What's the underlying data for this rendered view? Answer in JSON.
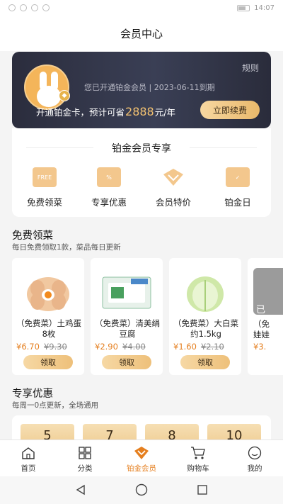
{
  "status_bar": {
    "time": "14:07"
  },
  "page": {
    "title": "会员中心"
  },
  "member_card": {
    "rule_link": "规则",
    "status_text": "您已开通铂金会员 | 2023-06-11到期",
    "promo_prefix": "开通铂金卡，预计可省",
    "promo_amount": "2888",
    "promo_suffix": "元/年",
    "renew_button": "立即续费"
  },
  "perks": {
    "title": "铂金会员专享",
    "items": [
      {
        "label": "免费领菜",
        "icon": "free-vegetable-icon",
        "icon_text": "FREE"
      },
      {
        "label": "专享优惠",
        "icon": "coupon-icon"
      },
      {
        "label": "会员特价",
        "icon": "diamond-tag-icon"
      },
      {
        "label": "铂金日",
        "icon": "calendar-icon"
      }
    ]
  },
  "free_dishes": {
    "title": "免费领菜",
    "subtitle": "每日免费领取1款，菜品每日更新",
    "items": [
      {
        "name": "（免费菜）土鸡蛋 8枚",
        "price": "¥6.70",
        "original_price": "¥9.30",
        "button": "领取"
      },
      {
        "name": "（免费菜）清美绢豆腐",
        "price": "¥2.90",
        "original_price": "¥4.00",
        "button": "领取"
      },
      {
        "name": "（免费菜）大白菜 约1.5kg",
        "price": "¥1.60",
        "original_price": "¥2.10",
        "button": "领取"
      },
      {
        "name": "（免",
        "line2": "娃娃",
        "price": "¥3.",
        "overlay": "已"
      }
    ]
  },
  "exclusive_deals": {
    "title": "专享优惠",
    "subtitle": "每周一0点更新，全场通用",
    "coupons": [
      "5",
      "7",
      "8",
      "10"
    ]
  },
  "tabbar": {
    "items": [
      {
        "label": "首页",
        "icon": "home-icon",
        "active": false
      },
      {
        "label": "分类",
        "icon": "grid-icon",
        "active": false
      },
      {
        "label": "铂金会员",
        "icon": "vip-diamond-icon",
        "active": true
      },
      {
        "label": "购物车",
        "icon": "cart-icon",
        "active": false
      },
      {
        "label": "我的",
        "icon": "profile-icon",
        "active": false
      }
    ]
  },
  "colors": {
    "accent": "#e57f1f",
    "gold": "#f2c171",
    "card_bg": "#2b2d3d"
  }
}
